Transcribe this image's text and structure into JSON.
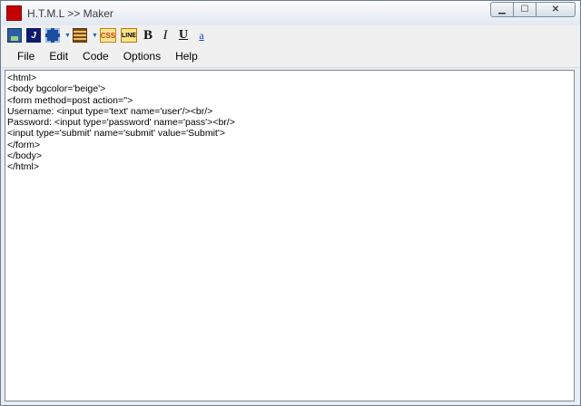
{
  "window": {
    "title": "H.T.M.L >> Maker"
  },
  "controls": {
    "minimize": "▁",
    "maximize": "☐",
    "close": "✕"
  },
  "toolbar": {
    "java_glyph": "J",
    "css_label": "CSS",
    "line_label": "LINE",
    "bold_label": "B",
    "italic_label": "I",
    "underline_label": "U",
    "link_label": "a",
    "dropdown_glyph": "▼"
  },
  "menu": {
    "items": [
      "File",
      "Edit",
      "Code",
      "Options",
      "Help"
    ]
  },
  "editor": {
    "lines": [
      "<html>",
      "<body bgcolor='beige'>",
      "<form method=post action=''>",
      "Username: <input type='text' name='user'/><br/>",
      "Password: <input type='password' name='pass'><br/>",
      "<input type='submit' name='submit' value='Submit'>",
      "</form>",
      "</body>",
      "</html>"
    ]
  }
}
